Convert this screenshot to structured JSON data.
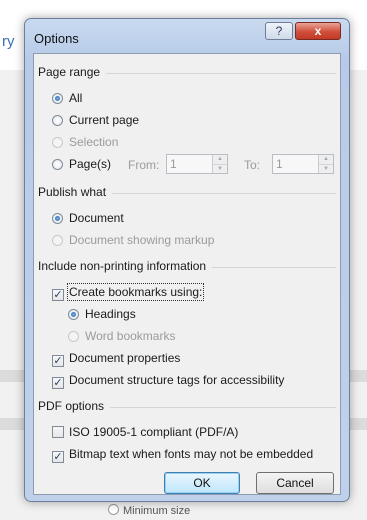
{
  "background": {
    "fragment": "ry",
    "bottom_text": "Minimum size"
  },
  "dialog": {
    "title": "Options",
    "help_glyph": "?",
    "close_glyph": "x"
  },
  "page_range": {
    "label": "Page range",
    "options": [
      {
        "label": "All",
        "selected": true,
        "enabled": true
      },
      {
        "label": "Current page",
        "selected": false,
        "enabled": true
      },
      {
        "label": "Selection",
        "selected": false,
        "enabled": false
      },
      {
        "label": "Page(s)",
        "selected": false,
        "enabled": true
      }
    ],
    "from_label": "From:",
    "from_value": "1",
    "to_label": "To:",
    "to_value": "1"
  },
  "publish_what": {
    "label": "Publish what",
    "options": [
      {
        "label": "Document",
        "selected": true,
        "enabled": true
      },
      {
        "label": "Document showing markup",
        "selected": false,
        "enabled": false
      }
    ]
  },
  "non_printing": {
    "label": "Include non-printing information",
    "create_bookmarks": {
      "label": "Create bookmarks using:",
      "checked": true
    },
    "bookmark_options": [
      {
        "label": "Headings",
        "selected": true,
        "enabled": true
      },
      {
        "label": "Word bookmarks",
        "selected": false,
        "enabled": false
      }
    ],
    "document_properties": {
      "label": "Document properties",
      "checked": true
    },
    "structure_tags": {
      "label": "Document structure tags for accessibility",
      "checked": true
    }
  },
  "pdf_options": {
    "label": "PDF options",
    "iso": {
      "label": "ISO 19005-1 compliant (PDF/A)",
      "checked": false
    },
    "bitmap": {
      "label": "Bitmap text when fonts may not be embedded",
      "checked": true
    }
  },
  "buttons": {
    "ok": "OK",
    "cancel": "Cancel"
  },
  "icons": {
    "check_mark": "✓",
    "spin_up": "▲",
    "spin_down": "▼"
  }
}
